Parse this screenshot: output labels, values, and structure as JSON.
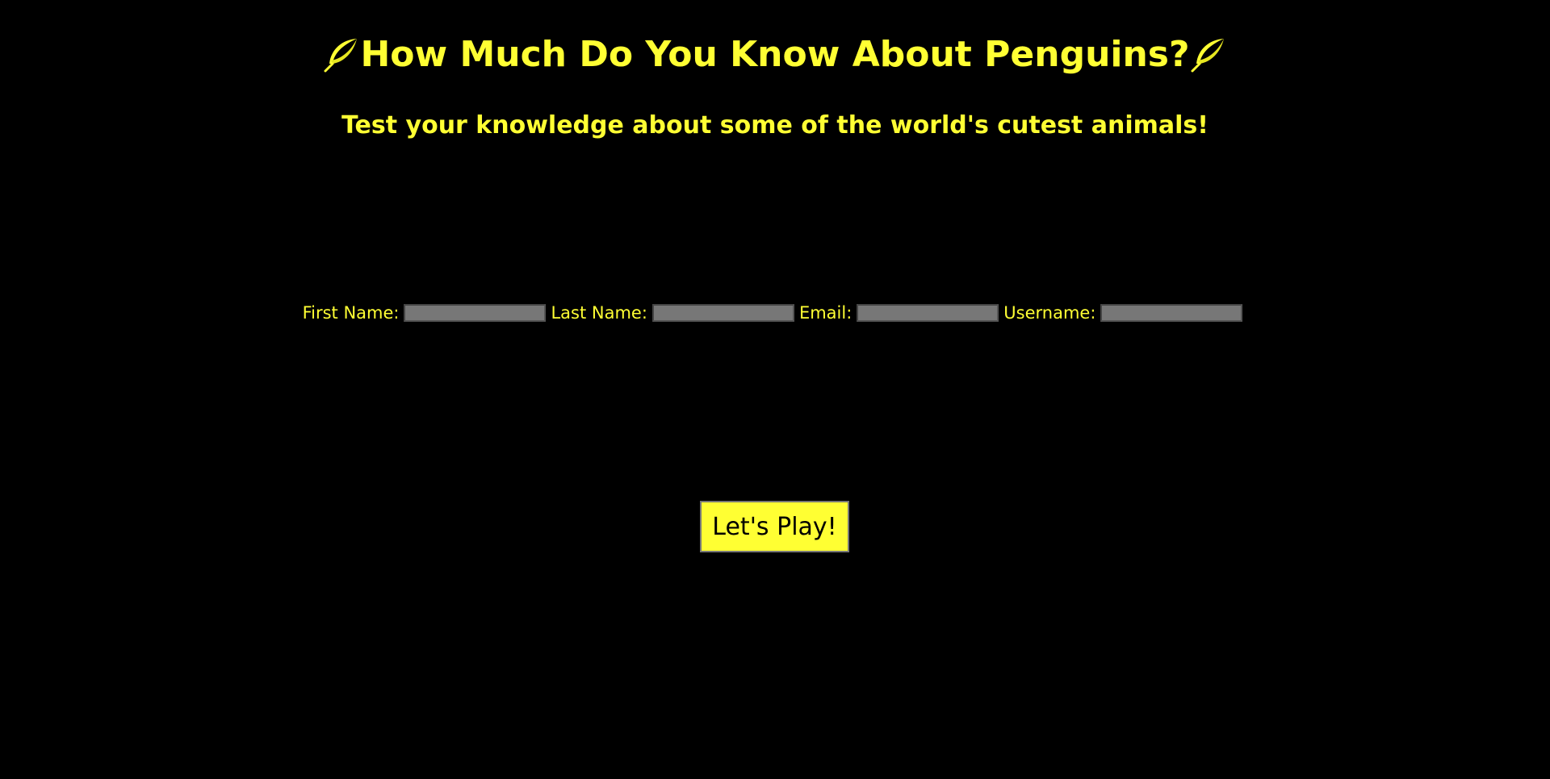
{
  "page": {
    "title": "How Much Do You Know About Penguins?",
    "title_icon": "feather-icon",
    "subtitle": "Test your knowledge about some of the world's cutest animals!",
    "colors": {
      "background": "#000000",
      "accent": "#FFFF33",
      "input_fill": "#777777"
    }
  },
  "form": {
    "first_name_label": "First Name:",
    "first_name_value": "",
    "last_name_label": "Last Name:",
    "last_name_value": "",
    "email_label": "Email:",
    "email_value": "",
    "username_label": "Username:",
    "username_value": ""
  },
  "actions": {
    "play_label": "Let's Play!"
  }
}
